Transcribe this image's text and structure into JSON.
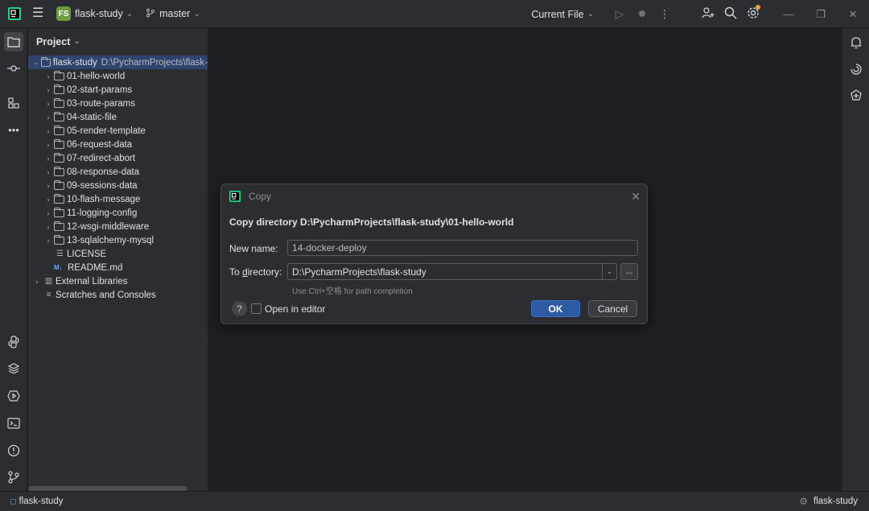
{
  "titlebar": {
    "project_badge": "FS",
    "project_name": "flask-study",
    "branch": "master",
    "run_config": "Current File"
  },
  "project_panel": {
    "title": "Project",
    "tree": [
      {
        "label": "flask-study",
        "hint": "D:\\PycharmProjects\\flask-",
        "type": "root",
        "expanded": true
      },
      {
        "label": "01-hello-world",
        "type": "folder"
      },
      {
        "label": "02-start-params",
        "type": "folder"
      },
      {
        "label": "03-route-params",
        "type": "folder"
      },
      {
        "label": "04-static-file",
        "type": "folder"
      },
      {
        "label": "05-render-template",
        "type": "folder"
      },
      {
        "label": "06-request-data",
        "type": "folder"
      },
      {
        "label": "07-redirect-abort",
        "type": "folder"
      },
      {
        "label": "08-response-data",
        "type": "folder"
      },
      {
        "label": "09-sessions-data",
        "type": "folder"
      },
      {
        "label": "10-flash-message",
        "type": "folder"
      },
      {
        "label": "11-logging-config",
        "type": "folder"
      },
      {
        "label": "12-wsgi-middleware",
        "type": "folder"
      },
      {
        "label": "13-sqlalchemy-mysql",
        "type": "folder"
      },
      {
        "label": "LICENSE",
        "type": "file"
      },
      {
        "label": "README.md",
        "type": "md"
      },
      {
        "label": "External Libraries",
        "type": "libs"
      },
      {
        "label": "Scratches and Consoles",
        "type": "scratches"
      }
    ]
  },
  "dialog": {
    "title": "Copy",
    "heading": "Copy directory D:\\PycharmProjects\\flask-study\\01-hello-world",
    "new_name_label": "New name:",
    "new_name_value": "14-docker-deploy",
    "to_directory_label_prefix": "To ",
    "to_directory_label_mnemonic": "d",
    "to_directory_label_suffix": "irectory:",
    "to_directory_value": "D:\\PycharmProjects\\flask-study",
    "browse_label": "...",
    "hint": "Use Ctrl+空格 for path completion",
    "help_label": "?",
    "open_in_editor_label": "Open in editor",
    "ok_label": "OK",
    "cancel_label": "Cancel"
  },
  "statusbar": {
    "left_project": "flask-study",
    "right_project": "flask-study"
  },
  "colors": {
    "accent": "#2c5aa5",
    "selection": "#2e436e",
    "background": "#1e1f22",
    "panel": "#2b2d30"
  }
}
